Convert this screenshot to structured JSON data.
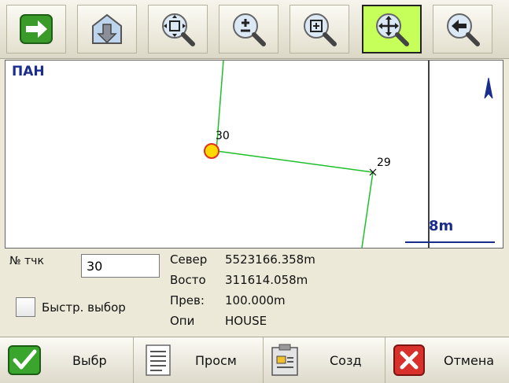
{
  "toolbar": {
    "buttons": [
      {
        "icon": "right-arrow-icon",
        "active": false
      },
      {
        "icon": "download-arrow-icon",
        "active": false
      },
      {
        "icon": "zoom-extents-icon",
        "active": false
      },
      {
        "icon": "zoom-in-out-icon",
        "active": false
      },
      {
        "icon": "zoom-window-icon",
        "active": false
      },
      {
        "icon": "pan-icon",
        "active": true
      },
      {
        "icon": "back-arrow-icon",
        "active": false
      }
    ]
  },
  "map": {
    "mode_label": "ПАН",
    "scale_label": "8m",
    "points": [
      {
        "label": "30",
        "selected": true
      },
      {
        "label": "29",
        "selected": false
      }
    ],
    "colors": {
      "line": "#1fbf2a",
      "point_fill": "#ffd800",
      "point_stroke": "#e0301e",
      "label": "#1a2d8c",
      "north": "#1a2d8c"
    }
  },
  "info": {
    "point_no_label": "№ тчк",
    "point_no_value": "30",
    "quick_select_label": "Быстр. выбор",
    "north_label": "Север",
    "north_value": "5523166.358m",
    "east_label": "Восто",
    "east_value": "311614.058m",
    "elev_label": "Прев:",
    "elev_value": "100.000m",
    "desc_label": "Опи",
    "desc_value": "HOUSE"
  },
  "bottom": {
    "select_label": "Выбр",
    "review_label": "Просм",
    "create_label": "Созд",
    "cancel_label": "Отмена"
  }
}
